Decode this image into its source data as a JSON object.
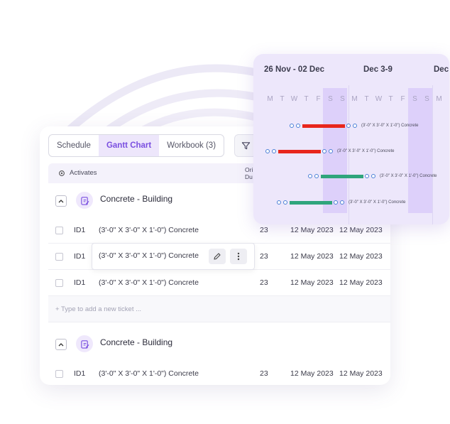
{
  "tabs": [
    {
      "label": "Schedule"
    },
    {
      "label": "Gantt Chart"
    },
    {
      "label": "Workbook (3)"
    }
  ],
  "table": {
    "activities_header": "Activates",
    "orig_header_1": "Ori",
    "orig_header_2": "Du"
  },
  "groups": [
    {
      "title": "Concrete - Building"
    },
    {
      "title": "Concrete - Building"
    }
  ],
  "rows": [
    {
      "id": "ID1",
      "name": "(3'-0\" X 3'-0\" X 1'-0\") Concrete",
      "qty": "23",
      "date1": "12 May 2023",
      "date2": "12 May 2023"
    },
    {
      "id": "ID1",
      "name": "(3'-0\" X 3'-0\" X 1'-0\") Concrete",
      "qty": "23",
      "date1": "12 May 2023",
      "date2": "12 May 2023"
    },
    {
      "id": "ID1",
      "name": "(3'-0\" X 3'-0\" X 1'-0\") Concrete",
      "qty": "23",
      "date1": "12 May 2023",
      "date2": "12 May 2023"
    },
    {
      "id": "ID1",
      "name": "(3'-0\" X 3'-0\" X 1'-0\") Concrete",
      "qty": "23",
      "date1": "12 May 2023",
      "date2": "12 May 2023"
    }
  ],
  "add_ticket_placeholder": "+ Type to add a new ticket ...",
  "gantt": {
    "weeks": [
      "26 Nov - 02 Dec",
      "Dec 3-9",
      "Dec"
    ],
    "days": [
      "M",
      "T",
      "W",
      "T",
      "F",
      "S",
      "S",
      "M",
      "T",
      "W",
      "T",
      "F",
      "S",
      "S",
      "M"
    ],
    "bars": [
      {
        "label": "(3'-0\" X 3'-0\" X 1'-0\") Concrete",
        "color": "#e8261c"
      },
      {
        "label": "(3'-0\" X 3'-0\" X 1'-0\") Concrete",
        "color": "#e8261c"
      },
      {
        "label": "(3'-0\" X 3'-0\" X 1'-0\") Concrete",
        "color": "#2fa57c"
      },
      {
        "label": "(3'-0\" X 3'-0\" X 1'-0\") Concrete",
        "color": "#2fa57c"
      }
    ]
  },
  "colors": {
    "accent": "#7a4fe0",
    "accent_bg": "#ede6fb",
    "gantt_bg": "#ede7fb"
  },
  "icons": {
    "filter": "filter-icon",
    "gear": "gear-icon",
    "edit": "pencil-icon",
    "more": "more-vertical-icon",
    "group": "clipboard-edit-icon",
    "chevron": "chevron-up-icon"
  }
}
